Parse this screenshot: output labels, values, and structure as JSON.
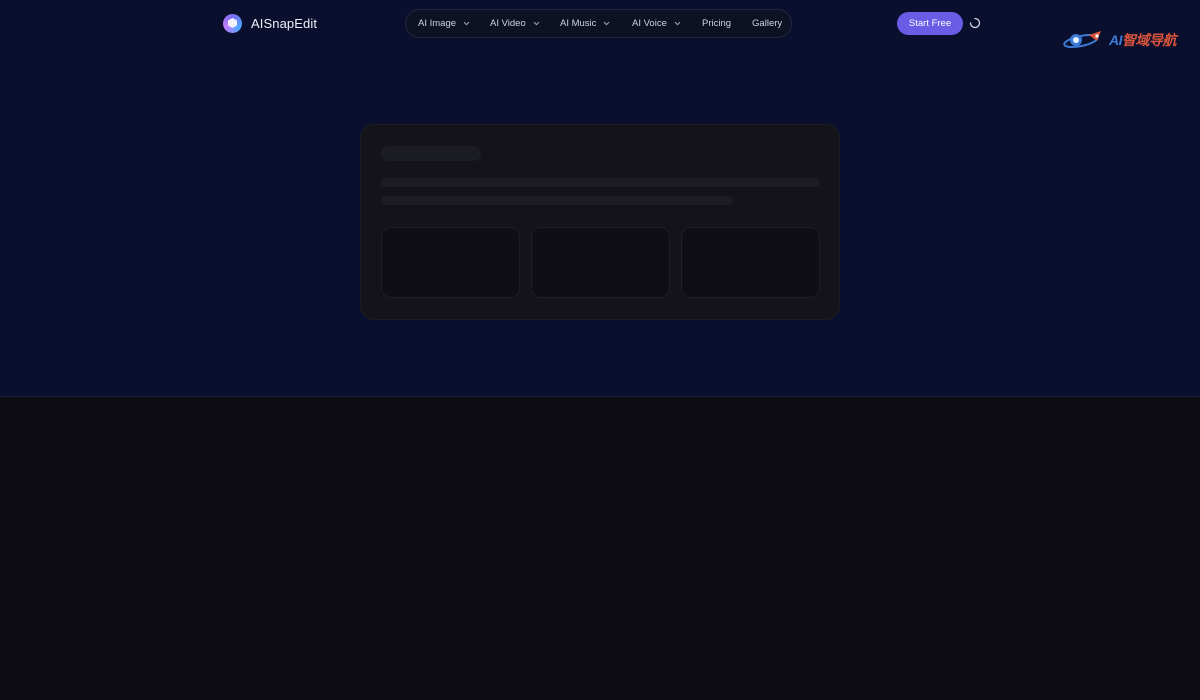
{
  "brand": {
    "name": "AISnapEdit",
    "logo_icon": "hexagon-logo-icon"
  },
  "nav": {
    "items": [
      {
        "label": "AI Image",
        "has_dropdown": true
      },
      {
        "label": "AI Video",
        "has_dropdown": true
      },
      {
        "label": "AI Music",
        "has_dropdown": true
      },
      {
        "label": "AI Voice",
        "has_dropdown": true
      },
      {
        "label": "Pricing",
        "has_dropdown": false
      },
      {
        "label": "Gallery",
        "has_dropdown": false
      }
    ]
  },
  "header": {
    "cta_label": "Start Free",
    "loading_icon": "spinner-icon"
  },
  "overlay_badge": {
    "text_ai": "AI",
    "text_cn": "智域导航"
  },
  "colors": {
    "hero_bg": "#0a0f2d",
    "page_bg": "#0c0c12",
    "accent": "#6b5ce6",
    "card_bg": "#131319"
  }
}
